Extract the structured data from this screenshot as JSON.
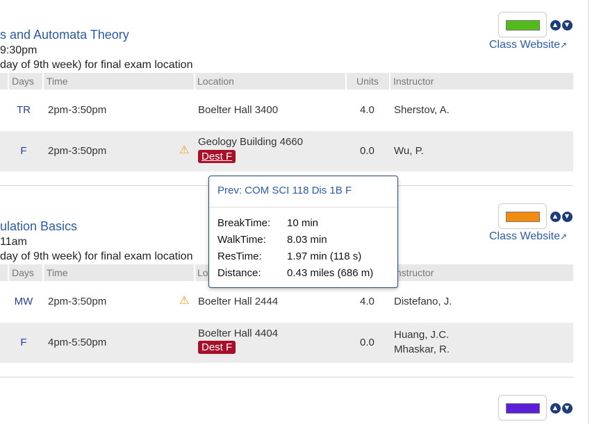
{
  "courses": [
    {
      "title": "s and Automata Theory",
      "line1": "9:30pm",
      "line2": "day of 9th week) for final exam location",
      "color": "#52bb1b",
      "website": "Class Website",
      "rows": [
        {
          "days": "TR",
          "time": "2pm-3:50pm",
          "location": "Boelter Hall 3400",
          "units": "4.0",
          "instructor": "Sherstov, A.",
          "warn": false
        },
        {
          "days": "F",
          "time": "2pm-3:50pm",
          "location": "Geology Building 4660",
          "badge": "Dest F",
          "units": "0.0",
          "instructor": "Wu, P.",
          "warn": true
        }
      ]
    },
    {
      "title": "ulation Basics",
      "line1": "11am",
      "line2": "day of 9th week) for final exam location",
      "color": "#f28c0f",
      "website": "Class Website",
      "rows": [
        {
          "days": "MW",
          "time": "2pm-3:50pm",
          "location": "Boelter Hall 2444",
          "units": "4.0",
          "instructor": "Distefano, J.",
          "warn": true
        },
        {
          "days": "F",
          "time": "4pm-5:50pm",
          "location": "Boelter Hall 4404",
          "badge": "Dest F",
          "units": "0.0",
          "instructor": "Huang, J.C.",
          "instructor2": "Mhaskar, R.",
          "warn": false
        }
      ]
    },
    {
      "color": "#5a1fd6"
    }
  ],
  "headers": {
    "days": "Days",
    "time": "Time",
    "location": "Location",
    "units": "Units",
    "instructor": "Instructor"
  },
  "tooltip": {
    "title": "Prev:  COM SCI 118 Dis 1B F",
    "rows": [
      {
        "label": "BreakTime:",
        "value": "10 min"
      },
      {
        "label": "WalkTime:",
        "value": "8.03 min"
      },
      {
        "label": "ResTime:",
        "value": "1.97 min (118 s)"
      },
      {
        "label": "Distance:",
        "value": "0.43 miles (686 m)"
      }
    ]
  },
  "icons": {
    "up": "arrow-up-circle",
    "down": "arrow-down-circle",
    "warn": "warning-triangle",
    "external": "external-link"
  }
}
